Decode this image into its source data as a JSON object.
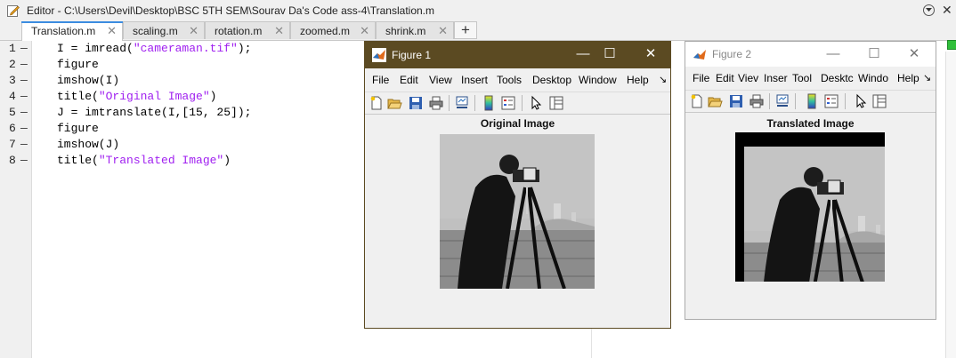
{
  "editor": {
    "title": "Editor - C:\\Users\\Devil\\Desktop\\BSC 5TH SEM\\Sourav Da's Code ass-4\\Translation.m",
    "tabs": [
      {
        "label": "Translation.m",
        "active": true
      },
      {
        "label": "scaling.m"
      },
      {
        "label": "rotation.m"
      },
      {
        "label": "zoomed.m"
      },
      {
        "label": "shrink.m"
      }
    ],
    "add_tab": "+",
    "close_glyph": "✕",
    "line_marker": "—",
    "lines": [
      {
        "n": "1",
        "pre": "I = imread(",
        "str": "\"cameraman.tif\"",
        "post": ");"
      },
      {
        "n": "2",
        "pre": "figure",
        "str": "",
        "post": ""
      },
      {
        "n": "3",
        "pre": "imshow(I)",
        "str": "",
        "post": ""
      },
      {
        "n": "4",
        "pre": "title(",
        "str": "\"Original Image\"",
        "post": ")"
      },
      {
        "n": "5",
        "pre": "J = imtranslate(I,[15, 25]);",
        "str": "",
        "post": ""
      },
      {
        "n": "6",
        "pre": "figure",
        "str": "",
        "post": ""
      },
      {
        "n": "7",
        "pre": "imshow(J)",
        "str": "",
        "post": ""
      },
      {
        "n": "8",
        "pre": "title(",
        "str": "\"Translated Image\"",
        "post": ")"
      }
    ]
  },
  "figure1": {
    "title": "Figure 1",
    "menu": [
      "File",
      "Edit",
      "View",
      "Insert",
      "Tools",
      "Desktop",
      "Window",
      "Help"
    ],
    "axes_title": "Original Image"
  },
  "figure2": {
    "title": "Figure 2",
    "menu": [
      "File",
      "Edit",
      "Viev",
      "Inser",
      "Tool",
      "Desktc",
      "Windo",
      "Help"
    ],
    "axes_title": "Translated Image"
  },
  "window_buttons": {
    "minimize": "—",
    "maximize": "☐",
    "close": "✕"
  },
  "colors": {
    "accent": "#3c8ce0",
    "figure_active_title": "#5b4a22",
    "string": "#a020f0"
  }
}
